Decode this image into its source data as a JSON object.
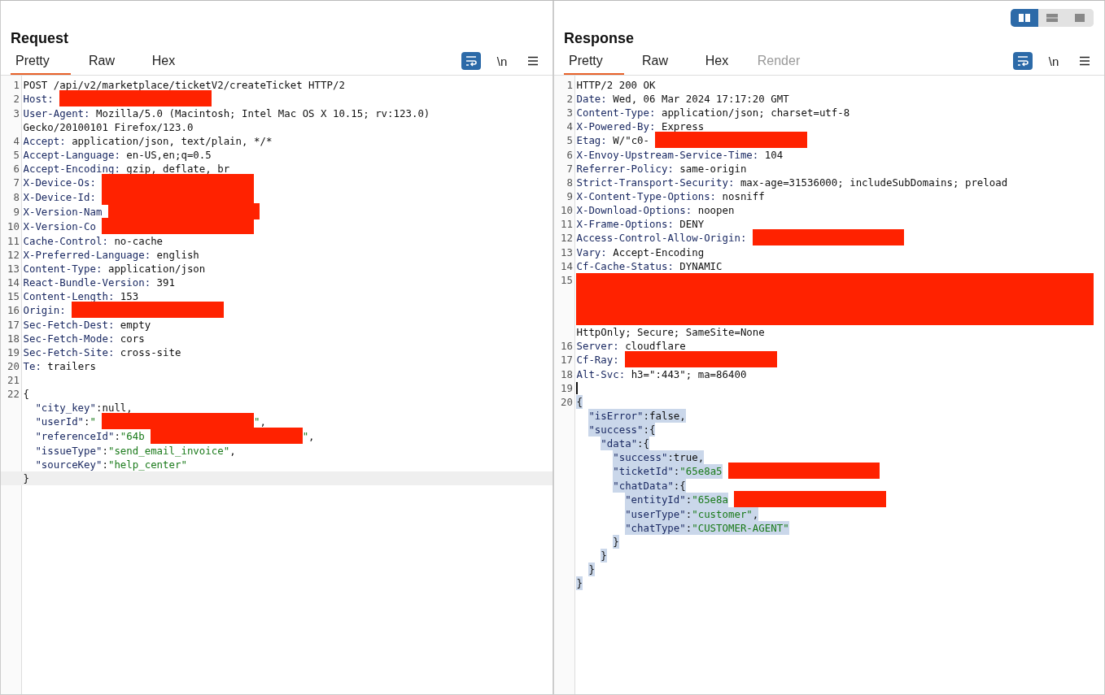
{
  "view_modes": [
    {
      "kind": "columns",
      "selected": true
    },
    {
      "kind": "rows",
      "selected": false
    },
    {
      "kind": "single",
      "selected": false
    }
  ],
  "panes": [
    {
      "title": "Request",
      "tabs": [
        {
          "label": "Pretty",
          "selected": true,
          "disabled": false
        },
        {
          "label": "Raw",
          "selected": false,
          "disabled": false
        },
        {
          "label": "Hex",
          "selected": false,
          "disabled": false
        }
      ],
      "tools": [
        {
          "kind": "wrap",
          "on": true
        },
        {
          "kind": "newline",
          "label": "\\n",
          "on": false
        },
        {
          "kind": "menu",
          "on": false
        }
      ],
      "lines": [
        {
          "number": "1",
          "parts": [
            {
              "kind": "text",
              "text": "POST /api/v2/marketplace/ticketV2/createTicket HTTP/2"
            }
          ]
        },
        {
          "number": "2",
          "parts": [
            {
              "kind": "key",
              "text": "Host:"
            },
            {
              "kind": "redaction"
            }
          ]
        },
        {
          "number": "3",
          "parts": [
            {
              "kind": "key",
              "text": "User-Agent:"
            },
            {
              "kind": "text",
              "text": " Mozilla/5.0 (Macintosh; Intel Mac OS X 10.15; rv:123.0)"
            }
          ]
        },
        {
          "parts": [
            {
              "kind": "text",
              "text": "Gecko/20100101 Firefox/123.0"
            }
          ]
        },
        {
          "number": "4",
          "parts": [
            {
              "kind": "key",
              "text": "Accept:"
            },
            {
              "kind": "text",
              "text": " application/json, text/plain, */*"
            }
          ]
        },
        {
          "number": "5",
          "parts": [
            {
              "kind": "key",
              "text": "Accept-Language:"
            },
            {
              "kind": "text",
              "text": " en-US,en;q=0.5"
            }
          ]
        },
        {
          "number": "6",
          "parts": [
            {
              "kind": "key",
              "text": "Accept-Encoding:"
            },
            {
              "kind": "text",
              "text": " gzip, deflate, br"
            }
          ]
        },
        {
          "number": "7",
          "parts": [
            {
              "kind": "key",
              "text": "X-Device-Os:"
            },
            {
              "kind": "redaction"
            }
          ]
        },
        {
          "number": "8",
          "parts": [
            {
              "kind": "key",
              "text": "X-Device-Id:"
            },
            {
              "kind": "redaction"
            }
          ]
        },
        {
          "number": "9",
          "parts": [
            {
              "kind": "key",
              "text": "X-Version-Nam"
            },
            {
              "kind": "redaction"
            }
          ]
        },
        {
          "number": "10",
          "parts": [
            {
              "kind": "key",
              "text": "X-Version-Co"
            },
            {
              "kind": "redaction"
            }
          ]
        },
        {
          "number": "11",
          "parts": [
            {
              "kind": "key",
              "text": "Cache-Control:"
            },
            {
              "kind": "text",
              "text": " no-cache"
            }
          ]
        },
        {
          "number": "12",
          "parts": [
            {
              "kind": "key",
              "text": "X-Preferred-Language:"
            },
            {
              "kind": "text",
              "text": " english"
            }
          ]
        },
        {
          "number": "13",
          "parts": [
            {
              "kind": "key",
              "text": "Content-Type:"
            },
            {
              "kind": "text",
              "text": " application/json"
            }
          ]
        },
        {
          "number": "14",
          "parts": [
            {
              "kind": "key",
              "text": "React-Bundle-Version:"
            },
            {
              "kind": "text",
              "text": " 391"
            }
          ]
        },
        {
          "number": "15",
          "parts": [
            {
              "kind": "key",
              "text": "Content-Length:"
            },
            {
              "kind": "text",
              "text": " 153"
            }
          ]
        },
        {
          "number": "16",
          "parts": [
            {
              "kind": "key",
              "text": "Origin:"
            },
            {
              "kind": "redaction"
            }
          ]
        },
        {
          "number": "17",
          "parts": [
            {
              "kind": "key",
              "text": "Sec-Fetch-Dest:"
            },
            {
              "kind": "text",
              "text": " empty"
            }
          ]
        },
        {
          "number": "18",
          "parts": [
            {
              "kind": "key",
              "text": "Sec-Fetch-Mode:"
            },
            {
              "kind": "text",
              "text": " cors"
            }
          ]
        },
        {
          "number": "19",
          "parts": [
            {
              "kind": "key",
              "text": "Sec-Fetch-Site:"
            },
            {
              "kind": "text",
              "text": " cross-site"
            }
          ]
        },
        {
          "number": "20",
          "parts": [
            {
              "kind": "key",
              "text": "Te:"
            },
            {
              "kind": "text",
              "text": " trailers"
            }
          ]
        },
        {
          "number": "21"
        },
        {
          "number": "22",
          "parts": [
            {
              "kind": "text",
              "text": "{"
            }
          ],
          "children": [
            {
              "parts": [
                {
                  "kind": "key",
                  "text": "\"city_key\""
                },
                {
                  "kind": "text",
                  "text": ":null,"
                }
              ]
            },
            {
              "parts": [
                {
                  "kind": "key",
                  "text": "\"userId\""
                },
                {
                  "kind": "text",
                  "text": ":"
                },
                {
                  "kind": "string",
                  "text": "\""
                },
                {
                  "kind": "redaction"
                },
                {
                  "kind": "string",
                  "text": "\""
                },
                {
                  "kind": "text",
                  "text": ","
                }
              ]
            },
            {
              "parts": [
                {
                  "kind": "key",
                  "text": "\"referenceId\""
                },
                {
                  "kind": "text",
                  "text": ":"
                },
                {
                  "kind": "string",
                  "text": "\"64b"
                },
                {
                  "kind": "redaction"
                },
                {
                  "kind": "string",
                  "text": "\""
                },
                {
                  "kind": "text",
                  "text": ","
                }
              ]
            },
            {
              "parts": [
                {
                  "kind": "key",
                  "text": "\"issueType\""
                },
                {
                  "kind": "text",
                  "text": ":"
                },
                {
                  "kind": "string",
                  "text": "\"send_email_invoice\""
                },
                {
                  "kind": "text",
                  "text": ","
                }
              ]
            },
            {
              "parts": [
                {
                  "kind": "key",
                  "text": "\"sourceKey\""
                },
                {
                  "kind": "text",
                  "text": ":"
                },
                {
                  "kind": "string",
                  "text": "\"help_center\""
                }
              ]
            }
          ]
        },
        {
          "parts": [
            {
              "kind": "text",
              "text": "}"
            }
          ],
          "current": true
        }
      ]
    },
    {
      "title": "Response",
      "tabs": [
        {
          "label": "Pretty",
          "selected": true,
          "disabled": false
        },
        {
          "label": "Raw",
          "selected": false,
          "disabled": false
        },
        {
          "label": "Hex",
          "selected": false,
          "disabled": false
        },
        {
          "label": "Render",
          "selected": false,
          "disabled": true
        }
      ],
      "tools": [
        {
          "kind": "wrap",
          "on": true
        },
        {
          "kind": "newline",
          "label": "\\n",
          "on": false
        },
        {
          "kind": "menu",
          "on": false
        }
      ],
      "lines": [
        {
          "number": "1",
          "parts": [
            {
              "kind": "text",
              "text": "HTTP/2 200 OK"
            }
          ]
        },
        {
          "number": "2",
          "parts": [
            {
              "kind": "key",
              "text": "Date:"
            },
            {
              "kind": "text",
              "text": " Wed, 06 Mar 2024 17:17:20 GMT"
            }
          ]
        },
        {
          "number": "3",
          "parts": [
            {
              "kind": "key",
              "text": "Content-Type:"
            },
            {
              "kind": "text",
              "text": " application/json; charset=utf-8"
            }
          ]
        },
        {
          "number": "4",
          "parts": [
            {
              "kind": "key",
              "text": "X-Powered-By:"
            },
            {
              "kind": "text",
              "text": " Express"
            }
          ]
        },
        {
          "number": "5",
          "parts": [
            {
              "kind": "key",
              "text": "Etag:"
            },
            {
              "kind": "text",
              "text": " W/\"c0-"
            },
            {
              "kind": "redaction"
            }
          ]
        },
        {
          "number": "6",
          "parts": [
            {
              "kind": "key",
              "text": "X-Envoy-Upstream-Service-Time:"
            },
            {
              "kind": "text",
              "text": " 104"
            }
          ]
        },
        {
          "number": "7",
          "parts": [
            {
              "kind": "key",
              "text": "Referrer-Policy:"
            },
            {
              "kind": "text",
              "text": " same-origin"
            }
          ]
        },
        {
          "number": "8",
          "parts": [
            {
              "kind": "key",
              "text": "Strict-Transport-Security:"
            },
            {
              "kind": "text",
              "text": " max-age=31536000; includeSubDomains; preload"
            }
          ]
        },
        {
          "number": "9",
          "parts": [
            {
              "kind": "key",
              "text": "X-Content-Type-Options:"
            },
            {
              "kind": "text",
              "text": " nosniff"
            }
          ]
        },
        {
          "number": "10",
          "parts": [
            {
              "kind": "key",
              "text": "X-Download-Options:"
            },
            {
              "kind": "text",
              "text": " noopen"
            }
          ]
        },
        {
          "number": "11",
          "parts": [
            {
              "kind": "key",
              "text": "X-Frame-Options:"
            },
            {
              "kind": "text",
              "text": " DENY"
            }
          ]
        },
        {
          "number": "12",
          "parts": [
            {
              "kind": "key",
              "text": "Access-Control-Allow-Origin:"
            },
            {
              "kind": "redaction"
            }
          ]
        },
        {
          "number": "13",
          "parts": [
            {
              "kind": "key",
              "text": "Vary:"
            },
            {
              "kind": "text",
              "text": " Accept-Encoding"
            }
          ]
        },
        {
          "number": "14",
          "parts": [
            {
              "kind": "key",
              "text": "Cf-Cache-Status:"
            },
            {
              "kind": "text",
              "text": " DYNAMIC"
            }
          ]
        },
        {
          "number": "15",
          "parts": [
            {
              "kind": "block-redaction"
            }
          ]
        },
        {
          "parts": [
            {
              "kind": "text",
              "text": "HttpOnly; Secure; SameSite=None"
            }
          ]
        },
        {
          "number": "16",
          "parts": [
            {
              "kind": "key",
              "text": "Server:"
            },
            {
              "kind": "text",
              "text": " cloudflare"
            }
          ]
        },
        {
          "number": "17",
          "parts": [
            {
              "kind": "key",
              "text": "Cf-Ray:"
            },
            {
              "kind": "redaction"
            }
          ]
        },
        {
          "number": "18",
          "parts": [
            {
              "kind": "key",
              "text": "Alt-Svc:"
            },
            {
              "kind": "text",
              "text": " h3=\":443\"; ma=86400"
            }
          ]
        },
        {
          "number": "19",
          "caret": true
        },
        {
          "number": "20",
          "selected": true,
          "parts": [
            {
              "kind": "text",
              "text": "{"
            }
          ],
          "children": [
            {
              "selected": true,
              "parts": [
                {
                  "kind": "key",
                  "text": "\"isError\""
                },
                {
                  "kind": "text",
                  "text": ":false,"
                }
              ]
            },
            {
              "selected": true,
              "parts": [
                {
                  "kind": "key",
                  "text": "\"success\""
                },
                {
                  "kind": "text",
                  "text": ":{"
                }
              ],
              "children": [
                {
                  "selected": true,
                  "parts": [
                    {
                      "kind": "key",
                      "text": "\"data\""
                    },
                    {
                      "kind": "text",
                      "text": ":{"
                    }
                  ],
                  "children": [
                    {
                      "selected": true,
                      "parts": [
                        {
                          "kind": "key",
                          "text": "\"success\""
                        },
                        {
                          "kind": "text",
                          "text": ":true,"
                        }
                      ]
                    },
                    {
                      "selected": true,
                      "parts": [
                        {
                          "kind": "key",
                          "text": "\"ticketId\""
                        },
                        {
                          "kind": "text",
                          "text": ":"
                        },
                        {
                          "kind": "string",
                          "text": "\"65e8a5"
                        },
                        {
                          "kind": "redaction"
                        }
                      ]
                    },
                    {
                      "selected": true,
                      "parts": [
                        {
                          "kind": "key",
                          "text": "\"chatData\""
                        },
                        {
                          "kind": "text",
                          "text": ":{"
                        }
                      ],
                      "children": [
                        {
                          "selected": true,
                          "parts": [
                            {
                              "kind": "key",
                              "text": "\"entityId\""
                            },
                            {
                              "kind": "text",
                              "text": ":"
                            },
                            {
                              "kind": "string",
                              "text": "\"65e8a"
                            },
                            {
                              "kind": "redaction"
                            }
                          ]
                        },
                        {
                          "selected": true,
                          "parts": [
                            {
                              "kind": "key",
                              "text": "\"userType\""
                            },
                            {
                              "kind": "text",
                              "text": ":"
                            },
                            {
                              "kind": "string",
                              "text": "\"customer\""
                            },
                            {
                              "kind": "text",
                              "text": ","
                            }
                          ]
                        },
                        {
                          "selected": true,
                          "parts": [
                            {
                              "kind": "key",
                              "text": "\"chatType\""
                            },
                            {
                              "kind": "text",
                              "text": ":"
                            },
                            {
                              "kind": "string",
                              "text": "\"CUSTOMER-AGENT\""
                            }
                          ]
                        }
                      ]
                    },
                    {
                      "selected": true,
                      "parts": [
                        {
                          "kind": "text",
                          "text": "}"
                        }
                      ]
                    }
                  ]
                },
                {
                  "selected": true,
                  "parts": [
                    {
                      "kind": "text",
                      "text": "}"
                    }
                  ]
                }
              ]
            },
            {
              "selected": true,
              "parts": [
                {
                  "kind": "text",
                  "text": "}"
                }
              ]
            }
          ]
        },
        {
          "selected": true,
          "parts": [
            {
              "kind": "text",
              "text": "}"
            }
          ]
        }
      ]
    }
  ]
}
